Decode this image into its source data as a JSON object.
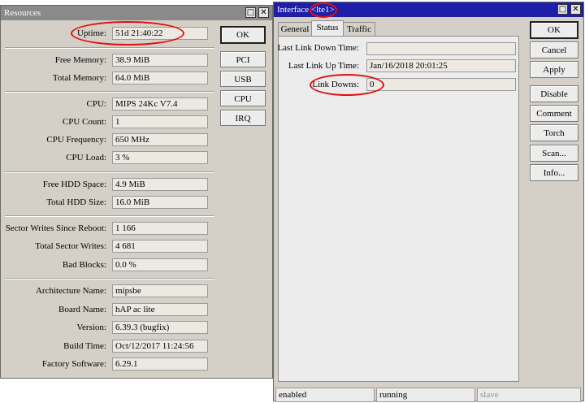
{
  "resources": {
    "title": "Resources",
    "fields": {
      "uptime": {
        "label": "Uptime:",
        "value": "51d 21:40:22"
      },
      "free_memory": {
        "label": "Free Memory:",
        "value": "38.9 MiB"
      },
      "total_memory": {
        "label": "Total Memory:",
        "value": "64.0 MiB"
      },
      "cpu": {
        "label": "CPU:",
        "value": "MIPS 24Kc V7.4"
      },
      "cpu_count": {
        "label": "CPU Count:",
        "value": "1"
      },
      "cpu_frequency": {
        "label": "CPU Frequency:",
        "value": "650 MHz"
      },
      "cpu_load": {
        "label": "CPU Load:",
        "value": "3 %"
      },
      "free_hdd": {
        "label": "Free HDD Space:",
        "value": "4.9 MiB"
      },
      "total_hdd": {
        "label": "Total HDD Size:",
        "value": "16.0 MiB"
      },
      "sector_writes_reboot": {
        "label": "Sector Writes Since Reboot:",
        "value": "1 166"
      },
      "total_sector_writes": {
        "label": "Total Sector Writes:",
        "value": "4 681"
      },
      "bad_blocks": {
        "label": "Bad Blocks:",
        "value": "0.0 %"
      },
      "architecture": {
        "label": "Architecture Name:",
        "value": "mipsbe"
      },
      "board": {
        "label": "Board Name:",
        "value": "hAP ac lite"
      },
      "version": {
        "label": "Version:",
        "value": "6.39.3 (bugfix)"
      },
      "build_time": {
        "label": "Build Time:",
        "value": "Oct/12/2017 11:24:56"
      },
      "factory_software": {
        "label": "Factory Software:",
        "value": "6.29.1"
      }
    },
    "buttons": {
      "ok": "OK",
      "pci": "PCI",
      "usb": "USB",
      "cpu": "CPU",
      "irq": "IRQ"
    },
    "titlebar_buttons": {
      "restore": "□",
      "close": "✕"
    }
  },
  "interface": {
    "title_prefix": "Interface ",
    "title_name": "<lte1>",
    "tabs": [
      "General",
      "Status",
      "Traffic"
    ],
    "fields": {
      "last_down": {
        "label": "Last Link Down Time:",
        "value": ""
      },
      "last_up": {
        "label": "Last Link Up Time:",
        "value": "Jan/16/2018 20:01:25"
      },
      "link_downs": {
        "label": "Link Downs:",
        "value": "0"
      }
    },
    "buttons": {
      "ok": "OK",
      "cancel": "Cancel",
      "apply": "Apply",
      "disable": "Disable",
      "comment": "Comment",
      "torch": "Torch",
      "scan": "Scan...",
      "info": "Info..."
    },
    "titlebar_buttons": {
      "restore": "□",
      "close": "✕"
    },
    "status_bar": [
      "enabled",
      "running",
      "slave"
    ]
  },
  "colors": {
    "annotation": "#e01010",
    "active_title": "#1e1ea8",
    "inactive_title": "#8a8a8a"
  }
}
